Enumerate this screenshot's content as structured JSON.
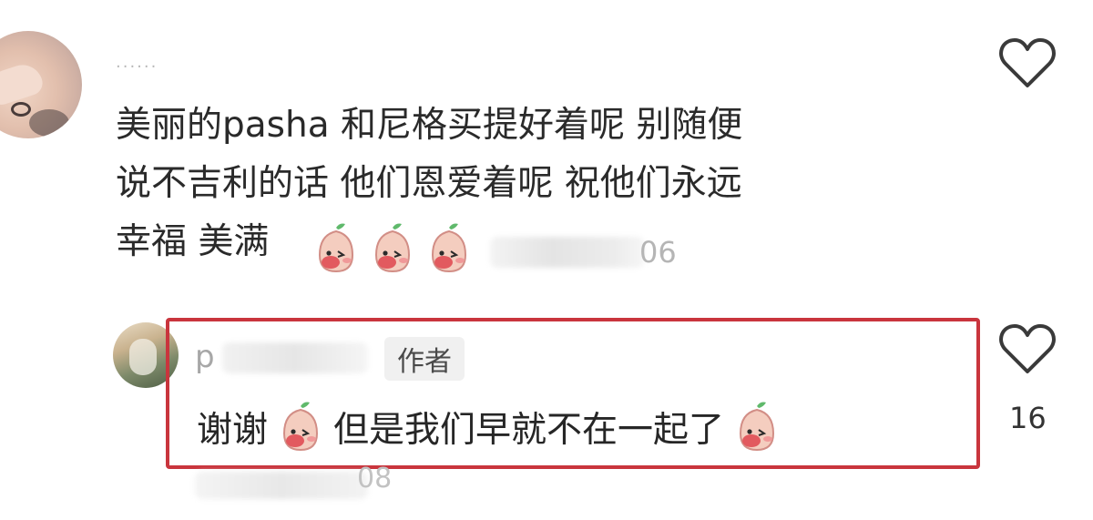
{
  "comment": {
    "username": "......",
    "text_lines": [
      "美丽的pasha 和尼格买提好着呢 别随便",
      "说不吉利的话 他们恩爱着呢  祝他们永远",
      "幸福 美满"
    ],
    "date_suffix": "06",
    "emojis": [
      "peach-emoji",
      "peach-emoji",
      "peach-emoji"
    ]
  },
  "reply": {
    "username_visible": "p",
    "author_badge": "作者",
    "text_before": "谢谢",
    "text_middle": "但是我们早就不在一起了",
    "date_suffix": "08",
    "like_count": "16"
  },
  "colors": {
    "highlight": "#c9353d",
    "text": "#2a2a2a",
    "muted": "#b5b5b5"
  },
  "icons": {
    "like": "heart-outline-icon",
    "emoji": "peach-emoji"
  }
}
